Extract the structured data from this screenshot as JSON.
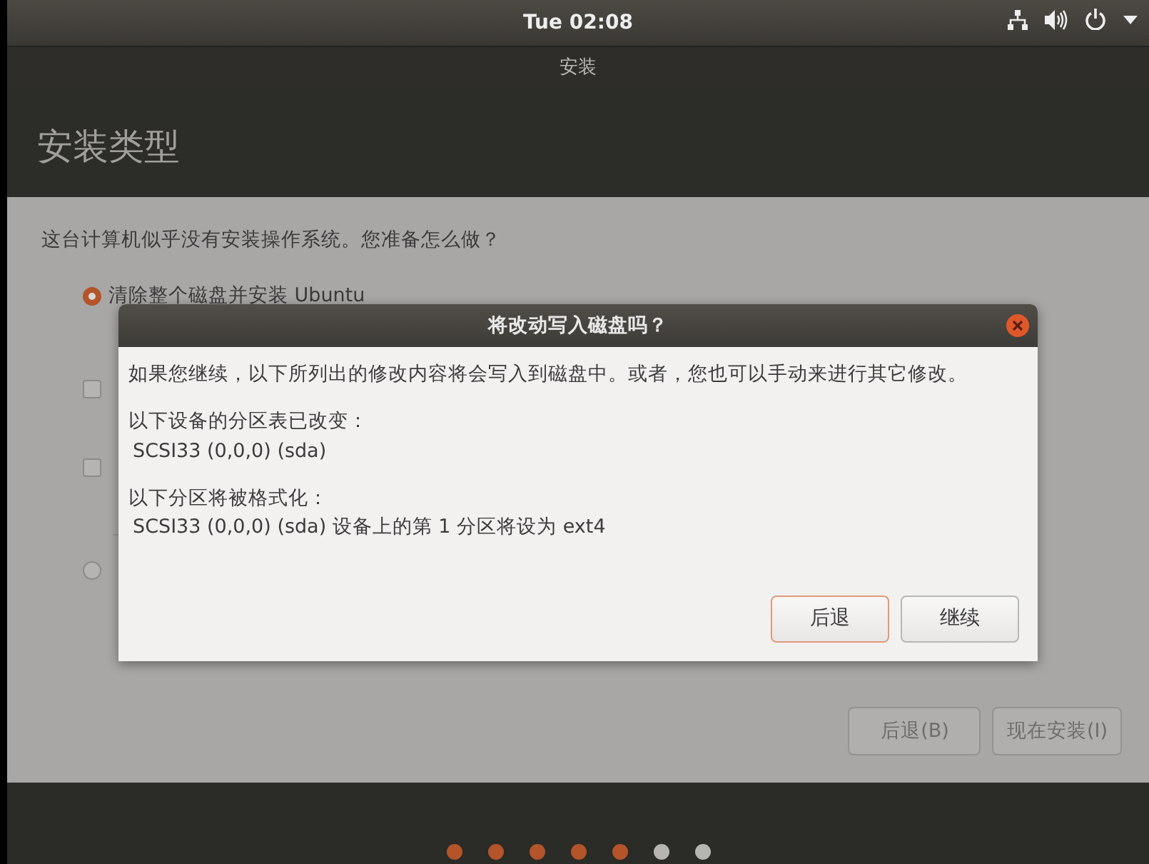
{
  "top_bar": {
    "clock": "Tue 02:08"
  },
  "window": {
    "title": "安装"
  },
  "page": {
    "heading": "安装类型",
    "question": "这台计算机似乎没有安装操作系统。您准备怎么做？",
    "options": [
      {
        "kind": "radio",
        "selected": true,
        "label": "清除整个磁盘并安装 Ubuntu"
      },
      {
        "kind": "checkbox",
        "checked": false
      },
      {
        "kind": "checkbox",
        "checked": false
      },
      {
        "kind": "radio",
        "selected": false
      }
    ],
    "buttons": [
      {
        "label": "后退(B)"
      },
      {
        "label": "现在安装(I)"
      }
    ]
  },
  "progress_dots": [
    {
      "done": true
    },
    {
      "done": true
    },
    {
      "done": true
    },
    {
      "done": true
    },
    {
      "done": true
    },
    {
      "done": false
    },
    {
      "done": false
    }
  ],
  "dialog": {
    "title": "将改动写入磁盘吗？",
    "intro": "如果您继续，以下所列出的修改内容将会写入到磁盘中。或者，您也可以手动来进行其它修改。",
    "sections": [
      {
        "heading": "以下设备的分区表已改变：",
        "item": "SCSI33 (0,0,0) (sda)"
      },
      {
        "heading": "以下分区将被格式化：",
        "item": "SCSI33 (0,0,0) (sda) 设备上的第 1 分区将设为 ext4"
      }
    ],
    "buttons": [
      {
        "label": "后退",
        "focused": true
      },
      {
        "label": "继续",
        "focused": false
      }
    ]
  }
}
